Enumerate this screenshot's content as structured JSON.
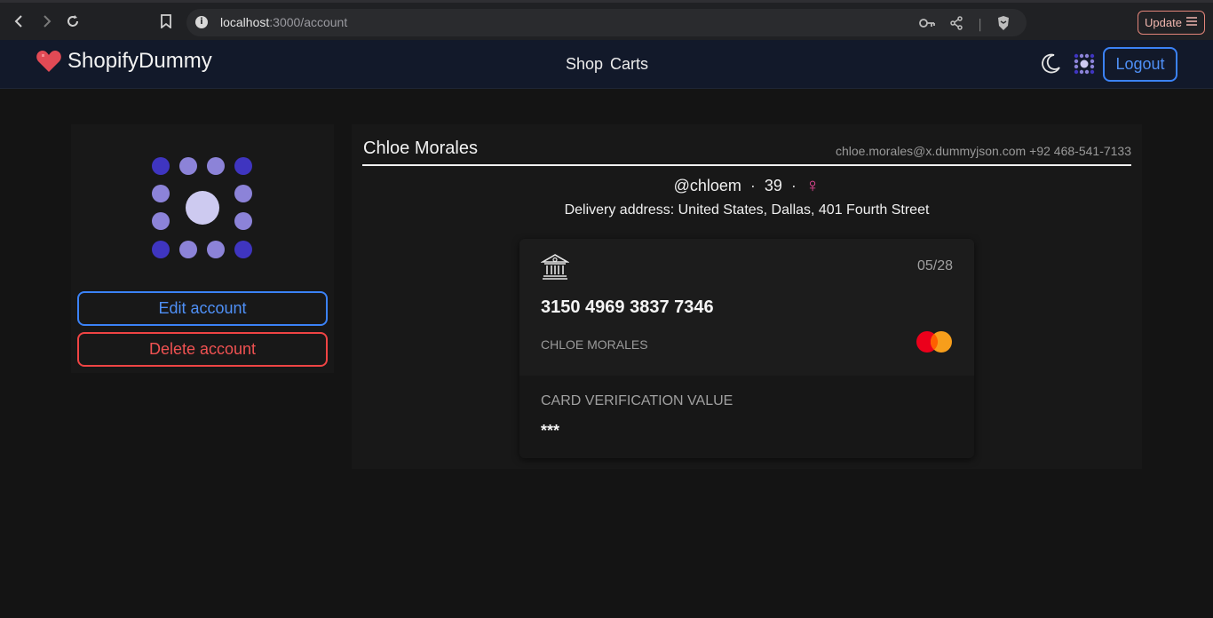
{
  "browser": {
    "url_host": "localhost",
    "url_path": ":3000/account",
    "update_label": "Update"
  },
  "app": {
    "brand": "ShopifyDummy",
    "nav": [
      "Shop",
      "Carts"
    ],
    "logout_label": "Logout"
  },
  "profile": {
    "edit_label": "Edit account",
    "delete_label": "Delete account",
    "name": "Chloe Morales",
    "email": "chloe.morales@x.dummyjson.com",
    "phone": "+92 468-541-7133",
    "username": "@chloem",
    "age": "39",
    "gender_symbol": "♀",
    "address": "Delivery address: United States, Dallas, 401 Fourth Street"
  },
  "card": {
    "expiry": "05/28",
    "number": "3150 4969 3837 7346",
    "holder": "CHLOE MORALES",
    "cvv_label": "CARD VERIFICATION VALUE",
    "cvv_value": "***",
    "brand_icon": "mastercard-icon"
  },
  "colors": {
    "accent_blue": "#3b82f6",
    "danger_red": "#ef4444",
    "gender_pink": "#ec4899",
    "avatar_dark": "#3f35c0",
    "avatar_light": "#8c83d8"
  }
}
